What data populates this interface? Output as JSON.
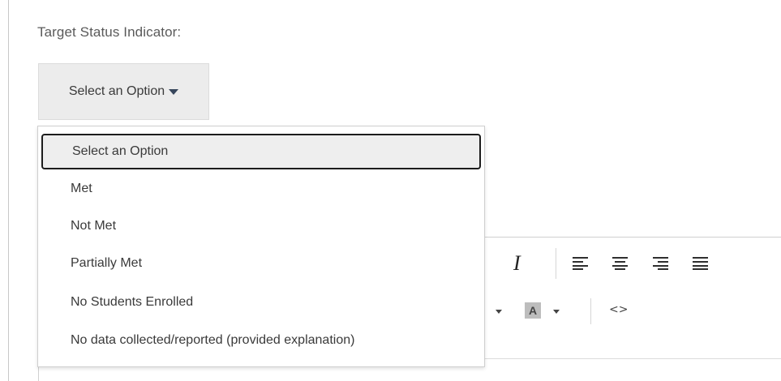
{
  "field": {
    "label": "Target Status Indicator:"
  },
  "select": {
    "current_value": "Select an Option",
    "options": [
      "Select an Option",
      "Met",
      "Not Met",
      "Partially Met",
      "No Students Enrolled",
      "No data collected/reported (provided explanation)"
    ],
    "selected_index": 0
  },
  "editor_toolbar": {
    "italic_label": "I",
    "font_color_label": "A",
    "code_label": "<>",
    "icons": [
      "italic-icon",
      "align-left-icon",
      "align-center-icon",
      "align-right-icon",
      "align-justify-icon",
      "chevron-down-icon",
      "font-color-icon",
      "code-view-icon"
    ]
  }
}
